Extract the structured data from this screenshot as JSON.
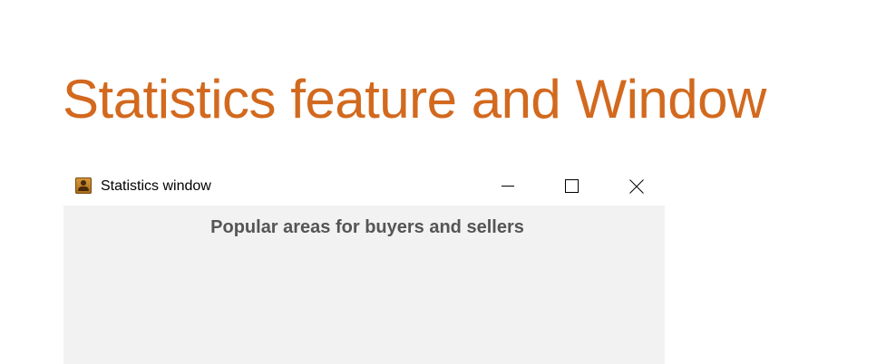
{
  "slide": {
    "title": "Statistics feature and Window",
    "title_color": "#D2691E"
  },
  "window": {
    "title": "Statistics window",
    "icon": "contacts-book-icon",
    "controls": {
      "minimize": "minimize-icon",
      "maximize": "maximize-icon",
      "close": "close-icon"
    }
  },
  "content": {
    "heading": "Popular areas for buyers and sellers",
    "background": "#F2F2F2"
  }
}
